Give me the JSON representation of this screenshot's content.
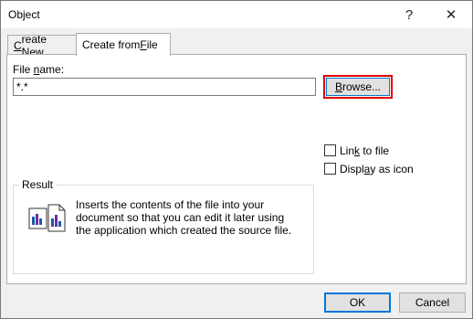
{
  "window": {
    "title": "Object",
    "help_label": "?",
    "close_label": "✕"
  },
  "tabs": [
    {
      "label_pre": "",
      "label_u": "C",
      "label_post": "reate New",
      "active": false
    },
    {
      "label_pre": "Create from ",
      "label_u": "F",
      "label_post": "ile",
      "active": true
    }
  ],
  "file": {
    "label_pre": "File ",
    "label_u": "n",
    "label_post": "ame:",
    "value": "*.*"
  },
  "browse_button": {
    "label_u": "B",
    "label_post": "rowse..."
  },
  "options": {
    "link": {
      "pre": "Lin",
      "u": "k",
      "post": " to file",
      "checked": false
    },
    "display": {
      "pre": "Displ",
      "u": "a",
      "post": "y as icon",
      "checked": false
    }
  },
  "result": {
    "title": "Result",
    "text": "Inserts the contents of the file into your document so that you can edit it later using the application which created the source file."
  },
  "footer": {
    "ok_label": "OK",
    "cancel_label": "Cancel"
  },
  "colors": {
    "highlight": "#e00000",
    "accent": "#0078d7"
  },
  "icons": [
    "help-icon",
    "close-icon",
    "result-document-icon"
  ]
}
